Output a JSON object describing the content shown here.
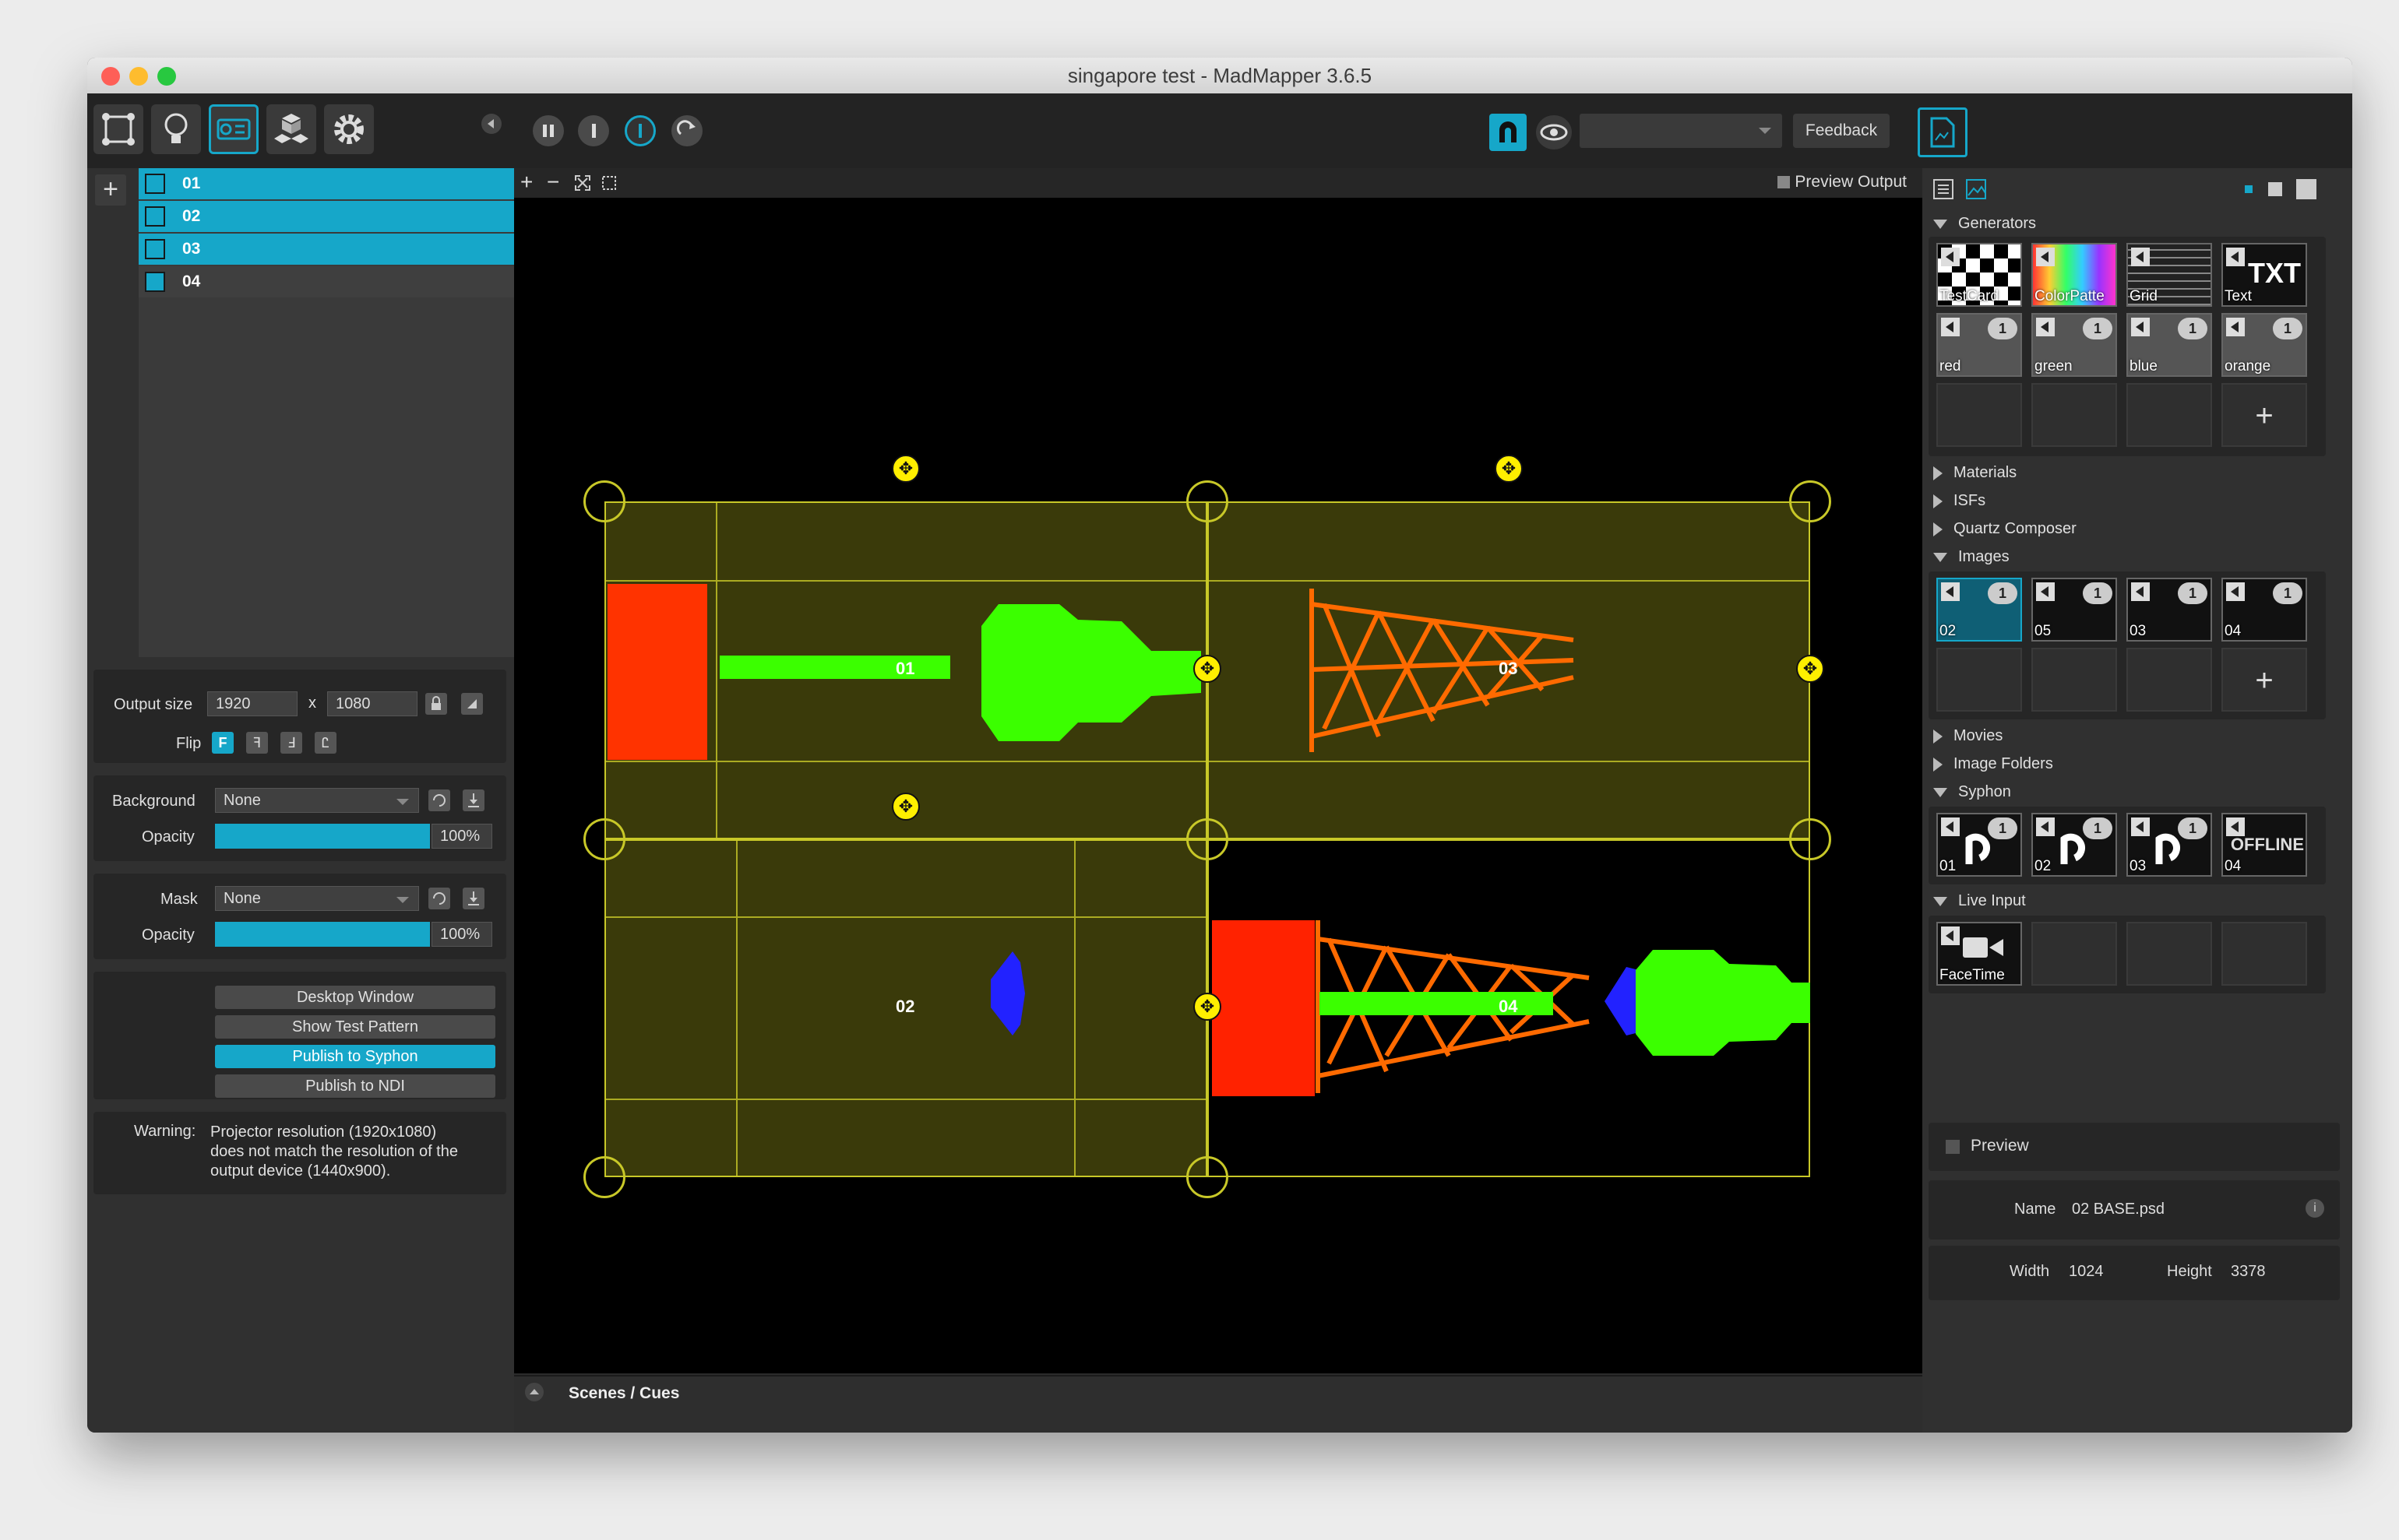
{
  "window": {
    "title": "singapore test - MadMapper 3.6.5"
  },
  "toolbar": {
    "feedback_label": "Feedback",
    "dropdown_value": ""
  },
  "surfaces": [
    {
      "label": "01",
      "selected": true
    },
    {
      "label": "02",
      "selected": true
    },
    {
      "label": "03",
      "selected": true
    },
    {
      "label": "04",
      "selected": false
    }
  ],
  "output": {
    "size_label": "Output size",
    "width": "1920",
    "x_sep": "x",
    "height": "1080",
    "flip_label": "Flip",
    "flip_options": [
      "F",
      "ꟻ",
      "Ⅎ",
      "Ꮭ"
    ]
  },
  "background": {
    "label": "Background",
    "value": "None",
    "opacity_label": "Opacity",
    "opacity": "100%",
    "opacity_level": 1.0
  },
  "mask": {
    "label": "Mask",
    "value": "None",
    "opacity_label": "Opacity",
    "opacity": "100%",
    "opacity_level": 1.0
  },
  "actions": {
    "desktop_window": "Desktop Window",
    "show_test_pattern": "Show Test Pattern",
    "publish_syphon": "Publish to Syphon",
    "publish_ndi": "Publish to NDI"
  },
  "warning": {
    "label": "Warning:",
    "line1": "Projector resolution (1920x1080)",
    "line2": "does not match the resolution of the",
    "line3": "output device (1440x900)."
  },
  "stage": {
    "preview_output": "Preview Output",
    "labels": [
      "01",
      "02",
      "03",
      "04"
    ],
    "zoom_in": "+",
    "zoom_out": "−"
  },
  "scenes": {
    "label": "Scenes / Cues"
  },
  "library": {
    "generators": {
      "label": "Generators",
      "tiles": [
        "TestCard",
        "ColorPatte",
        "Grid",
        "Text",
        "red",
        "green",
        "blue",
        "orange"
      ],
      "badge": "1"
    },
    "materials": "Materials",
    "isfs": "ISFs",
    "quartz": "Quartz Composer",
    "images": {
      "label": "Images",
      "tiles": [
        "02",
        "05",
        "03",
        "04"
      ],
      "badge": "1"
    },
    "movies": "Movies",
    "image_folders": "Image Folders",
    "syphon": {
      "label": "Syphon",
      "tiles": [
        "01",
        "02",
        "03",
        "04"
      ],
      "badge": "1",
      "offline_text": "OFFLINE"
    },
    "live_input": {
      "label": "Live Input",
      "tiles": [
        "FaceTime"
      ]
    },
    "plus": "+",
    "txt_glyph": "TXT"
  },
  "preview": {
    "label": "Preview"
  },
  "info": {
    "name_label": "Name",
    "name_value": "02 BASE.psd",
    "width_label": "Width",
    "width_value": "1024",
    "height_label": "Height",
    "height_value": "3378"
  },
  "colors": {
    "accent": "#16a7c9",
    "surface_fill": "#3a3a0a",
    "surface_line": "#c8c828",
    "green": "#3bff00",
    "orange": "#ff6a00",
    "red": "#ff2200",
    "blue": "#2222ff"
  }
}
